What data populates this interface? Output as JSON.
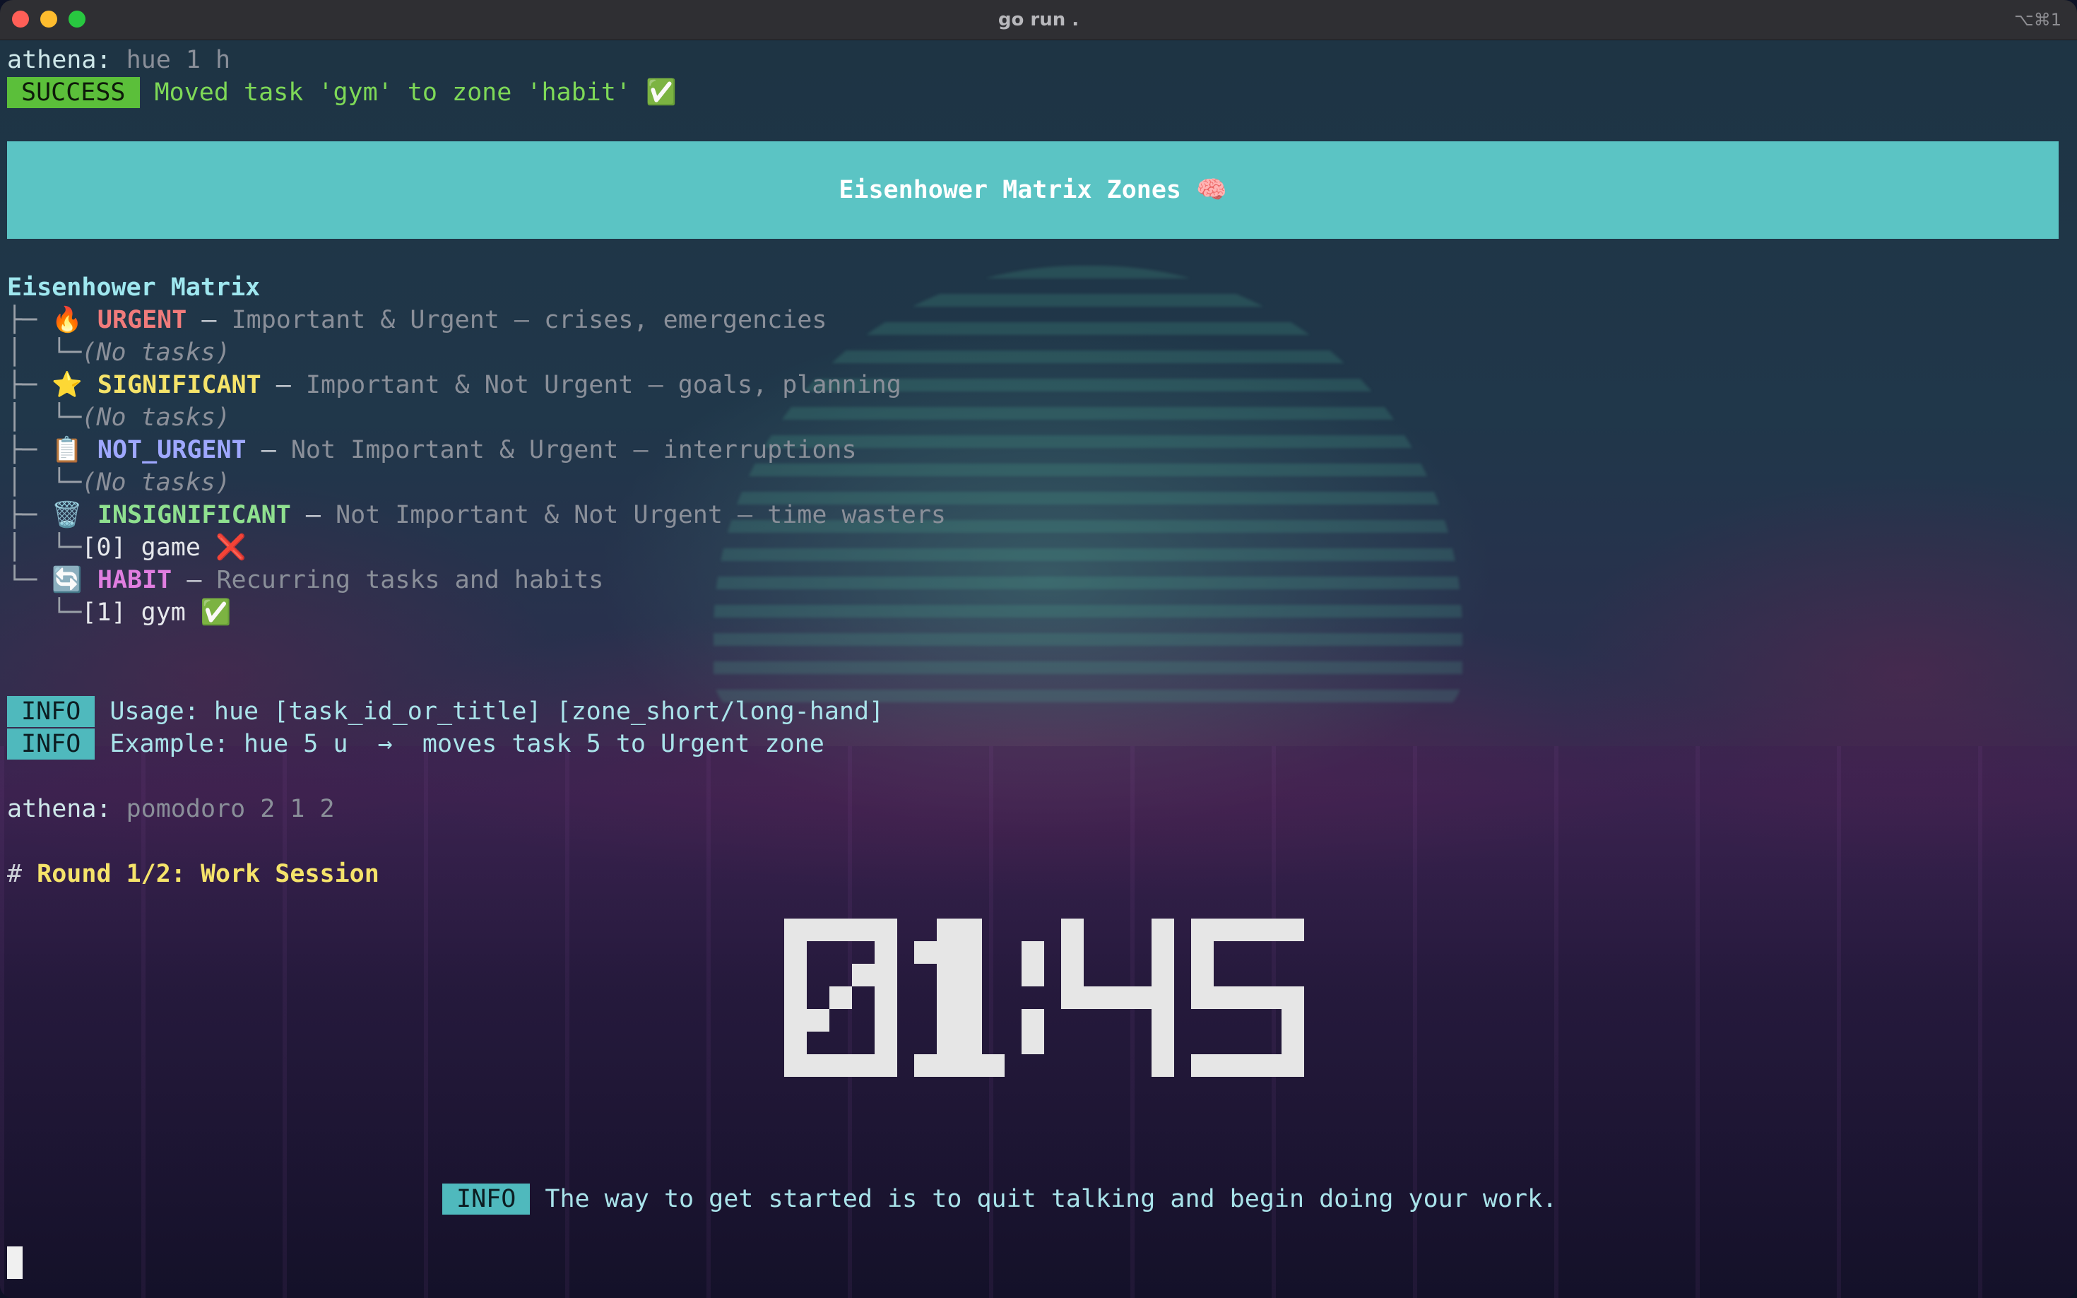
{
  "window": {
    "title": "go run .",
    "shortcut": "⌥⌘1"
  },
  "prompt_user": "athena:",
  "commands": {
    "first": "hue 1 h",
    "second": "pomodoro 2 1 2"
  },
  "success": {
    "badge": "SUCCESS",
    "message": "Moved task 'gym' to zone 'habit' ✅"
  },
  "banner": {
    "title": "Eisenhower Matrix Zones 🧠"
  },
  "matrix": {
    "title": "Eisenhower Matrix",
    "zones": [
      {
        "icon": "🔥",
        "name": "URGENT",
        "separator": "–",
        "description": "Important & Urgent – crises, emergencies",
        "items": [
          "(No tasks)"
        ]
      },
      {
        "icon": "⭐",
        "name": "SIGNIFICANT",
        "separator": "–",
        "description": "Important & Not Urgent – goals, planning",
        "items": [
          "(No tasks)"
        ]
      },
      {
        "icon": "📋",
        "name": "NOT_URGENT",
        "separator": "–",
        "description": "Not Important & Urgent – interruptions",
        "items": [
          "(No tasks)"
        ]
      },
      {
        "icon": "🗑️",
        "name": "INSIGNIFICANT",
        "separator": "–",
        "description": "Not Important & Not Urgent – time wasters",
        "items": [
          "[0] game ❌"
        ]
      },
      {
        "icon": "🔄",
        "name": "HABIT",
        "separator": "–",
        "description": "Recurring tasks and habits",
        "items": [
          "[1] gym ✅"
        ]
      }
    ]
  },
  "info": [
    {
      "badge": "INFO",
      "message": "Usage: hue [task_id_or_title] [zone_short/long-hand]"
    },
    {
      "badge": "INFO",
      "message": "Example: hue 5 u  →  moves task 5 to Urgent zone"
    }
  ],
  "pomodoro": {
    "round_hash": "#",
    "round_label": "Round 1/2: Work Session",
    "time": "01:45",
    "quote_badge": "INFO",
    "quote": "The way to get started is to quit talking and begin doing your work."
  },
  "colors": {
    "success_badge": "#5bbf3a",
    "info_badge": "#4fb9bd",
    "banner": "#5bc4c4",
    "urgent": "#f07b7b",
    "significant": "#f5e36a",
    "not_urgent": "#9fa8ff",
    "insignificant": "#8fe08f",
    "habit": "#e07ee0"
  }
}
